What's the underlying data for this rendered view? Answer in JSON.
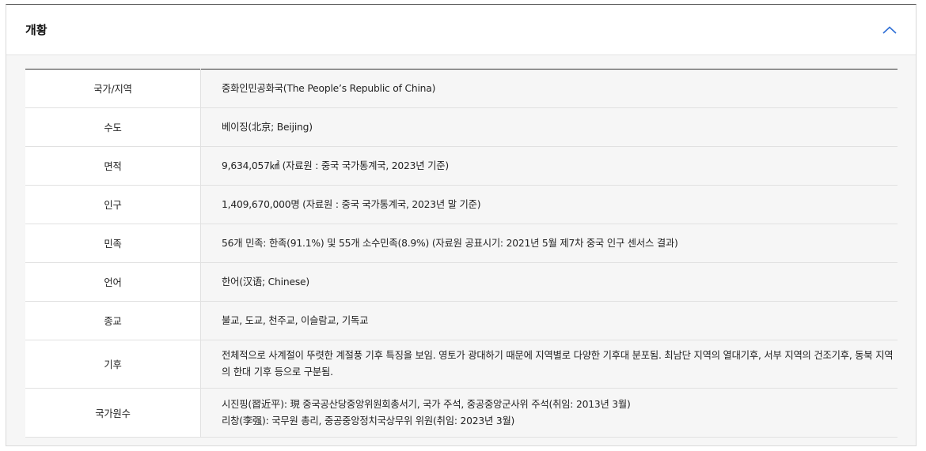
{
  "panel": {
    "title": "개황"
  },
  "rows": [
    {
      "label": "국가/지역",
      "values": [
        "중화인민공화국(The People’s Republic of China)"
      ]
    },
    {
      "label": "수도",
      "values": [
        "베이징(北京; Beijing)"
      ]
    },
    {
      "label": "면적",
      "values": [
        "9,634,057㎢ (자료원 : 중국 국가통계국, 2023년 기준)"
      ]
    },
    {
      "label": "인구",
      "values": [
        "1,409,670,000명 (자료원 : 중국 국가통계국, 2023년 말 기준)"
      ]
    },
    {
      "label": "민족",
      "values": [
        "56개 민족: 한족(91.1%) 및 55개 소수민족(8.9%)  (자료원 공표시기: 2021년 5월 제7차 중국 인구 센서스 결과)"
      ]
    },
    {
      "label": "언어",
      "values": [
        "한어(汉语; Chinese)"
      ]
    },
    {
      "label": "종교",
      "values": [
        "불교, 도교, 천주교, 이슬람교, 기독교"
      ]
    },
    {
      "label": "기후",
      "values": [
        "전체적으로 사계절이 뚜렷한 계절풍 기후 특징을 보임. 영토가 광대하기 때문에 지역별로 다양한 기후대 분포됨. 최남단 지역의 열대기후, 서부 지역의 건조기후, 동북 지역의 한대 기후 등으로 구분됨."
      ]
    },
    {
      "label": "국가원수",
      "values": [
        "시진핑(習近平): 現 중국공산당중앙위원회총서기, 국가 주석, 중공중앙군사위 주석(취임: 2013년 3월)",
        "리창(李强): 국무원 총리, 중공중앙정치국상무위 위원(취임: 2023년 3월)"
      ]
    }
  ],
  "icons": {
    "collapse": "chevron-up-icon",
    "accent": "#2f6fd6"
  }
}
